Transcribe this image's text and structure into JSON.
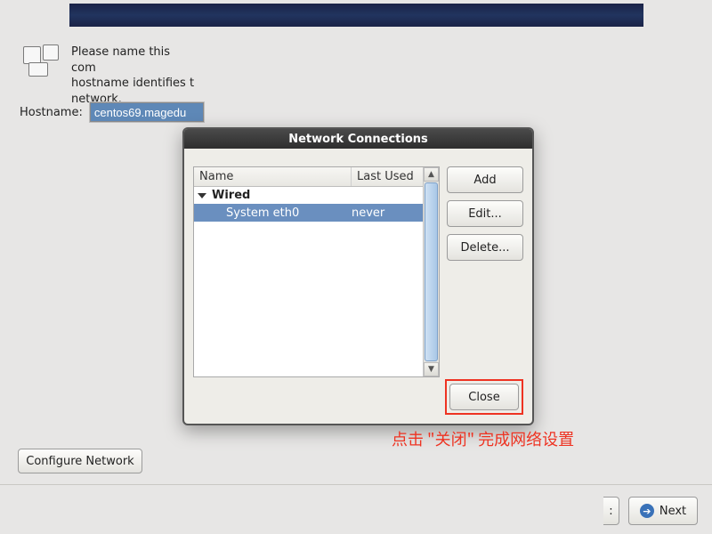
{
  "description": "Please name this com\nhostname identifies t\nnetwork.",
  "hostname_label": "Hostname:",
  "hostname_value": "centos69.magedu",
  "dialog": {
    "title": "Network Connections",
    "columns": {
      "name": "Name",
      "last_used": "Last Used"
    },
    "group": "Wired",
    "connection": {
      "name": "System eth0",
      "last_used": "never"
    },
    "buttons": {
      "add": "Add",
      "edit": "Edit...",
      "delete": "Delete...",
      "close": "Close"
    }
  },
  "annotation": "点击 \"关闭\" 完成网络设置",
  "configure_network": "Configure Network",
  "stub": ":",
  "next": "Next"
}
